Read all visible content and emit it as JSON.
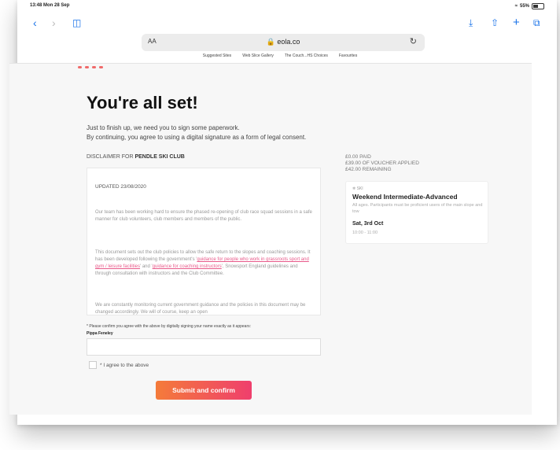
{
  "status": {
    "time": "13:48  Mon 28 Sep",
    "battery": "55%"
  },
  "browser": {
    "aa": "AA",
    "url": "eola.co",
    "favourites": [
      "Suggested Sites",
      "Web Slice Gallery",
      "The Couch...HS Choices",
      "Favourites"
    ]
  },
  "page": {
    "title": "You're all set!",
    "intro_1": "Just to finish up, we need you to sign some paperwork.",
    "intro_2": "By continuing, you agree to using a digital signature as a form of legal consent.",
    "disclaimer_prefix": "DISCLAIMER FOR",
    "disclaimer_club": "PENDLE SKI CLUB",
    "updated": "UPDATED 23/08/2020",
    "para_1": "Our team has been working hard to ensure the phased re-opening of club race squad sessions in a safe manner for club volunteers, club members and members of the public.",
    "para_2a": "This document sets out the club policies to allow the safe return to the slopes and coaching sessions. It has been developed following the government's '",
    "para_2_link1": "guidance for people who work in grassroots sport and gym / leisure facilities",
    "para_2b": "' and '",
    "para_2_link2": "guidance for coaching instructors",
    "para_2c": "', Snowsport England guidelines and through consultation with instructors and the Club Committee.",
    "para_3": "We are constantly monitoring current government guidance and the policies in this document may be changed accordingly. We will of course, keep an open",
    "confirm_note": "* Please confirm you agree with the above by digitally signing your name exactly as it appears:",
    "signer": "Pippa Feneley",
    "agree_label": "* I agree to the above",
    "submit_label": "Submit and confirm"
  },
  "summary": {
    "paid": "£0.00 PAID",
    "voucher": "£39.00 OF VOUCHER APPLIED",
    "remaining": "£42.00 REMAINING",
    "tag": "SKI",
    "course": "Weekend Intermediate-Advanced",
    "desc": "All ages. Participants must be proficient users of the main slope and tow",
    "date": "Sat, 3rd Oct",
    "time": "10:00 - 11:00"
  },
  "colors": {
    "accent": "#1a73e8",
    "button_start": "#f47b3a",
    "button_end": "#ef3f6d"
  }
}
